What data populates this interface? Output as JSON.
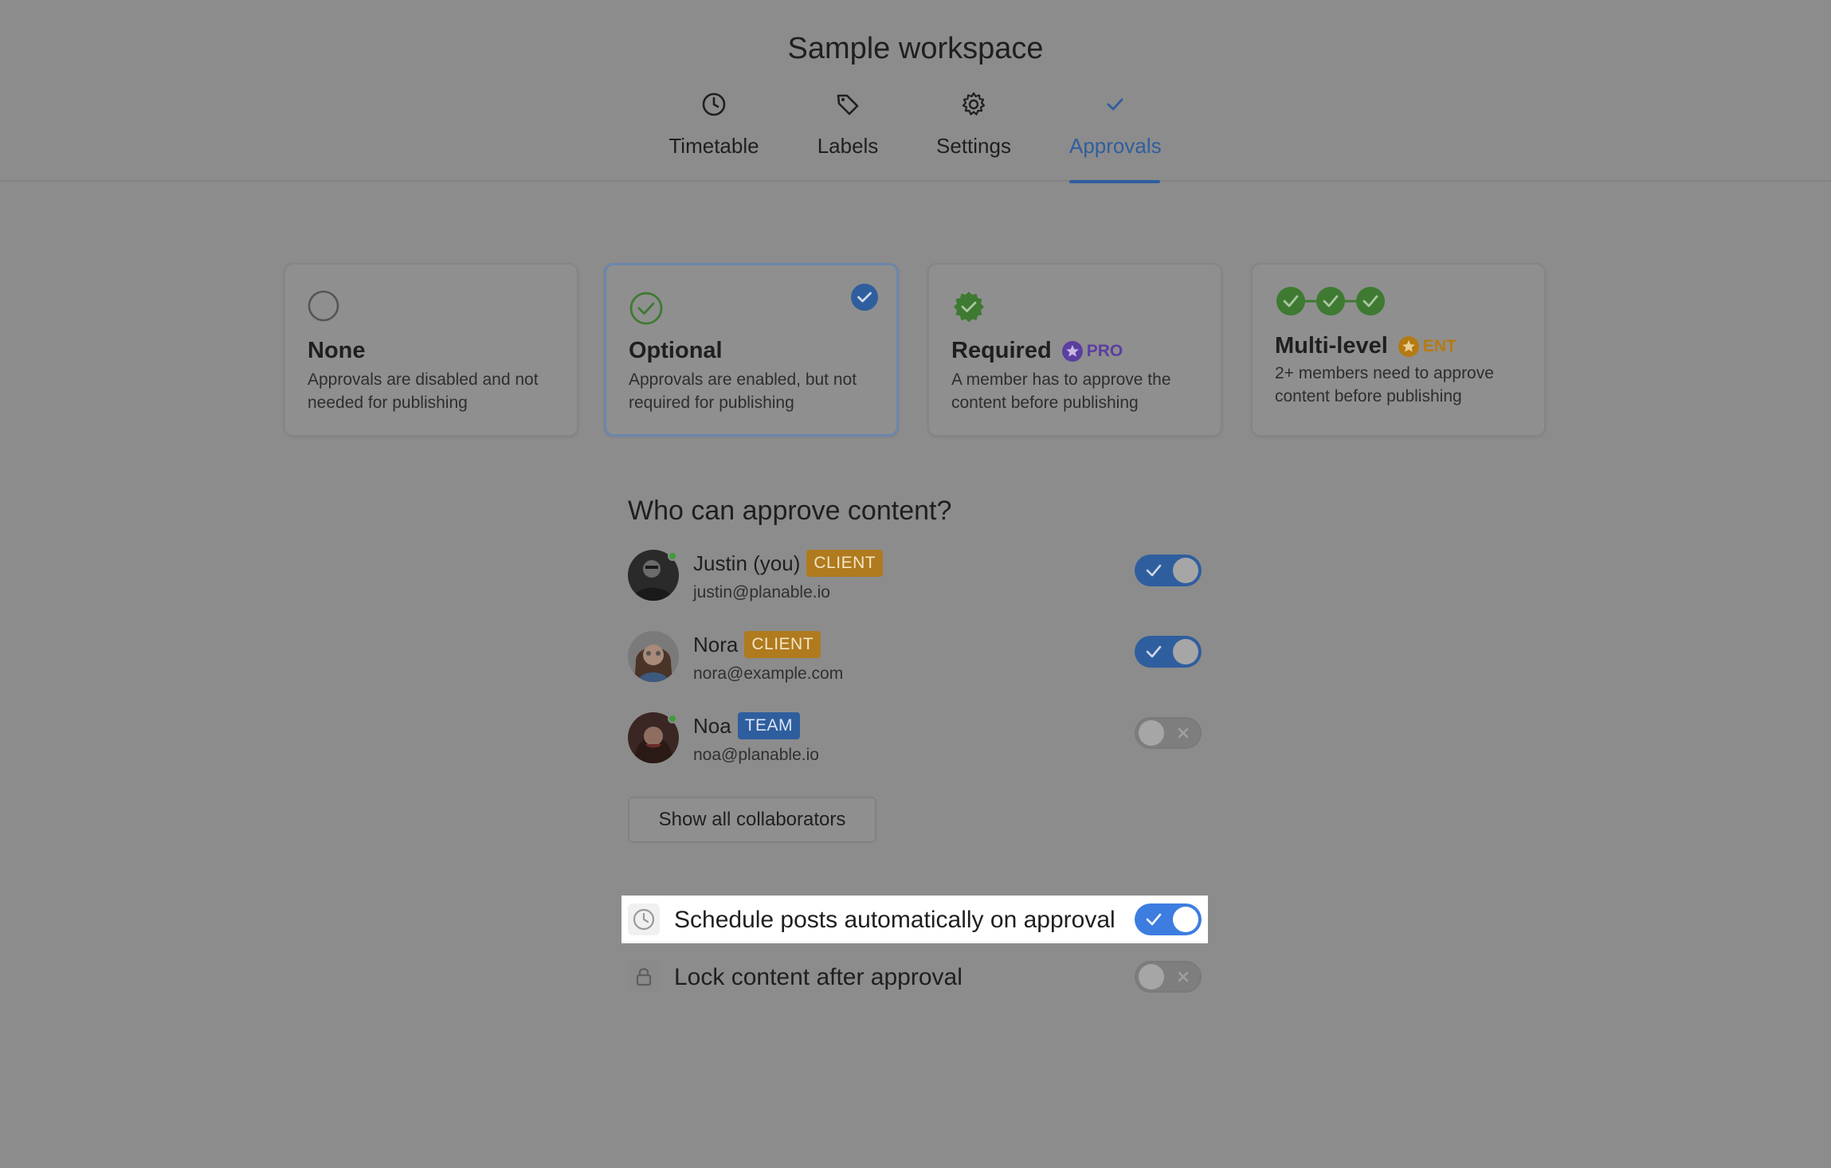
{
  "header": {
    "workspace_title": "Sample workspace",
    "tabs": [
      {
        "label": "Timetable",
        "icon": "clock-icon",
        "active": false
      },
      {
        "label": "Labels",
        "icon": "tag-icon",
        "active": false
      },
      {
        "label": "Settings",
        "icon": "gear-icon",
        "active": false
      },
      {
        "label": "Approvals",
        "icon": "check-icon",
        "active": true
      }
    ]
  },
  "approval_modes": [
    {
      "title": "None",
      "description": "Approvals are disabled and not needed for publishing",
      "selected": false
    },
    {
      "title": "Optional",
      "description": "Approvals are enabled, but not required for publishing",
      "selected": true
    },
    {
      "title": "Required",
      "badge": "PRO",
      "description": "A member has to approve the content before publishing",
      "selected": false
    },
    {
      "title": "Multi-level",
      "badge": "ENT",
      "description": "2+ members need to approve content before publishing",
      "selected": false
    }
  ],
  "approvers": {
    "title": "Who can approve content?",
    "people": [
      {
        "name": "Justin (you)",
        "role": "CLIENT",
        "email": "justin@planable.io",
        "enabled": true,
        "online": true
      },
      {
        "name": "Nora",
        "role": "CLIENT",
        "email": "nora@example.com",
        "enabled": true,
        "online": false
      },
      {
        "name": "Noa",
        "role": "TEAM",
        "email": "noa@planable.io",
        "enabled": false,
        "online": true
      }
    ],
    "show_all_label": "Show all collaborators"
  },
  "options": [
    {
      "label": "Schedule posts automatically on approval",
      "icon": "clock-icon",
      "enabled": true
    },
    {
      "label": "Lock content after approval",
      "icon": "lock-icon",
      "enabled": false
    }
  ],
  "colors": {
    "accent": "#2f5e9e",
    "client_badge": "#b07a1e",
    "success": "#3e9b3a",
    "pro": "#5b3fa0",
    "ent": "#b57a12"
  }
}
